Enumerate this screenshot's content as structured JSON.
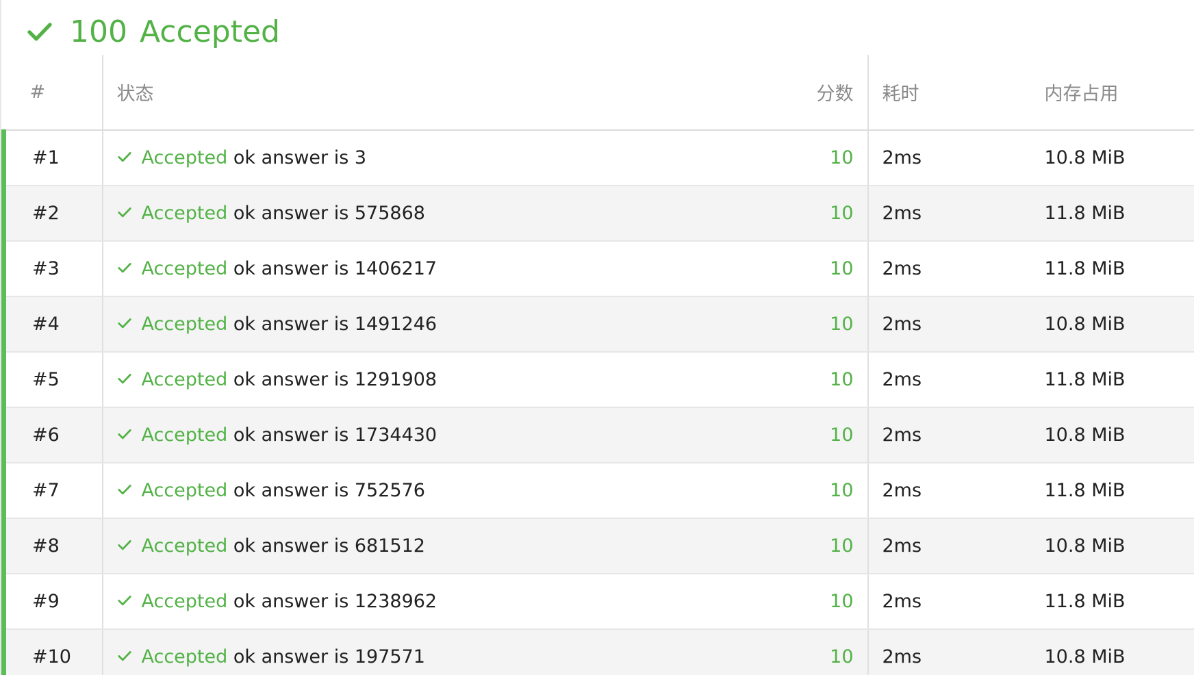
{
  "summary": {
    "icon": "check-icon",
    "score": "100",
    "verdict": "Accepted",
    "color": "#52b246"
  },
  "table": {
    "headers": {
      "num": "#",
      "status": "状态",
      "score": "分数",
      "time": "耗时",
      "memory": "内存占用"
    },
    "rows": [
      {
        "num": "#1",
        "verdict": "Accepted",
        "message": "ok answer is 3",
        "score": "10",
        "time": "2ms",
        "memory": "10.8 MiB"
      },
      {
        "num": "#2",
        "verdict": "Accepted",
        "message": "ok answer is 575868",
        "score": "10",
        "time": "2ms",
        "memory": "11.8 MiB"
      },
      {
        "num": "#3",
        "verdict": "Accepted",
        "message": "ok answer is 1406217",
        "score": "10",
        "time": "2ms",
        "memory": "11.8 MiB"
      },
      {
        "num": "#4",
        "verdict": "Accepted",
        "message": "ok answer is 1491246",
        "score": "10",
        "time": "2ms",
        "memory": "10.8 MiB"
      },
      {
        "num": "#5",
        "verdict": "Accepted",
        "message": "ok answer is 1291908",
        "score": "10",
        "time": "2ms",
        "memory": "11.8 MiB"
      },
      {
        "num": "#6",
        "verdict": "Accepted",
        "message": "ok answer is 1734430",
        "score": "10",
        "time": "2ms",
        "memory": "10.8 MiB"
      },
      {
        "num": "#7",
        "verdict": "Accepted",
        "message": "ok answer is 752576",
        "score": "10",
        "time": "2ms",
        "memory": "11.8 MiB"
      },
      {
        "num": "#8",
        "verdict": "Accepted",
        "message": "ok answer is 681512",
        "score": "10",
        "time": "2ms",
        "memory": "10.8 MiB"
      },
      {
        "num": "#9",
        "verdict": "Accepted",
        "message": "ok answer is 1238962",
        "score": "10",
        "time": "2ms",
        "memory": "11.8 MiB"
      },
      {
        "num": "#10",
        "verdict": "Accepted",
        "message": "ok answer is 197571",
        "score": "10",
        "time": "2ms",
        "memory": "10.8 MiB"
      }
    ]
  }
}
